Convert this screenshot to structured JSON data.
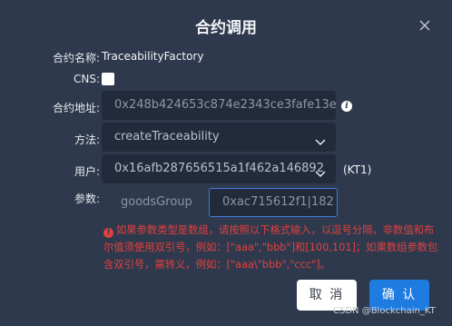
{
  "dialog": {
    "title": "合约调用"
  },
  "form": {
    "contract_name_label": "合约名称:",
    "contract_name_value": "TraceabilityFactory",
    "cns_label": "CNS:",
    "address_label": "合约地址:",
    "address_value": "0x248b424653c874e2343ce3fafe13e",
    "method_label": "方法:",
    "method_value": "createTraceability",
    "user_label": "用户:",
    "user_value": "0x16afb287656515a1f462a146892",
    "user_tag": "(KT1)",
    "params_label": "参数:",
    "param_name": "goodsGroup",
    "param_value": "0xac715612f1|182"
  },
  "warning": {
    "text": "如果参数类型是数组，请按照以下格式输入，以逗号分隔，非数值和布尔值须使用双引号，例如：[\"aaa\",\"bbb\"]和[100,101]；如果数组参数包含双引号，需转义，例如：[\"aaa\\\"bbb\",\"ccc\"]。"
  },
  "buttons": {
    "cancel": "取 消",
    "confirm": "确 认"
  },
  "watermark": "CSDN @Blockchain_KT",
  "colors": {
    "background": "#2f394d",
    "field": "#222b3b",
    "accent": "#1e7be0",
    "warning": "#e0413d"
  },
  "icons": {
    "close": "close-icon",
    "info": "info-icon",
    "dropdown": "chevron-down-icon",
    "warning": "warning-icon"
  }
}
